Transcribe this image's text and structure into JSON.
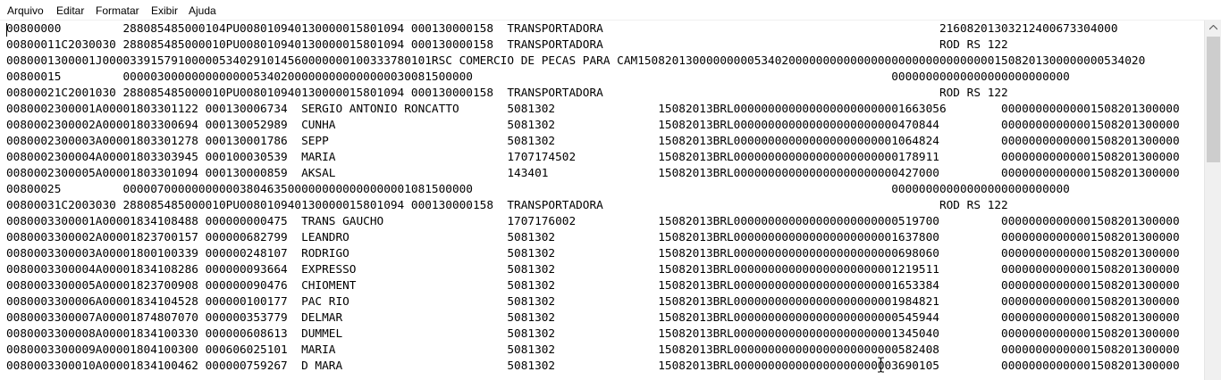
{
  "menu": {
    "items": [
      "Arquivo",
      "Editar",
      "Formatar",
      "Exibir",
      "Ajuda"
    ]
  },
  "document": {
    "lines": [
      "00800000         288085485000104PU008010940130000015801094 000130000158  TRANSPORTADORA                                                 21608201303212400673304000",
      "00800011C2030030 288085485000010PU008010940130000015801094 000130000158  TRANSPORTADORA                                                 ROD RS 122",
      "0080001300001J00003391579100000534029101456000000010033378010​1RSC COMERCIO DE PECAS PARA CAM15082013000000000534020000000000000000000000000000001508201300000000534020",
      "00800015         000003000000000000053402000000000000000030081500000                                                             00000000000000000000000000",
      "00800021C2001030 288085485000010PU008010940130000015801094 000130000158  TRANSPORTADORA                                                 ROD RS 122",
      "0080002300001A00001803301122 000130006734  SERGIO ANTONIO RONCATTO       5081302               15082013BRL0000000000000000000000001663056        00000000000001508201300000",
      "0080002300002A00001803300694 000130052989  CUNHA                         5081302               15082013BRL000000000000000000000000470844         00000000000001508201300000",
      "0080002300003A00001803301278 000130001786  SEPP                          5081302               15082013BRL000000000000000000000001064824         00000000000001508201300000",
      "0080002300004A00001803303945 000100030539  MARIA                         1707174502            15082013BRL000000000000000000000000178911         00000000000001508201300000",
      "0080002300005A00001803301094 000130000859  AKSAL                         143401                15082013BRL000000000000000000000000427000         00000000000001508201300000",
      "00800025         000007000000000003804635000000000000000001081500000                                                             00000000000000000000000000",
      "00800031C2003030 288085485000010PU008010940130000015801094 000130000158  TRANSPORTADORA                                                 ROD RS 122",
      "0080003300001A00001834108488 000000000475  TRANS GAUCHO                  1707176002            15082013BRL000000000000000000000000519700         00000000000001508201300000",
      "0080003300002A00001823700157 000000682799  LEANDRO                       5081302               15082013BRL000000000000000000000001637800         00000000000001508201300000",
      "0080003300003A00001800100339 000000248107  RODRIGO                       5081302               15082013BRL000000000000000000000000698060         00000000000001508201300000",
      "0080003300004A00001834108286 000000093664  EXPRESSO                      5081302               15082013BRL000000000000000000000001219511         00000000000001508201300000",
      "0080003300005A00001823700908 000000090476  CHIOMENT                      5081302               15082013BRL000000000000000000000001653384         00000000000001508201300000",
      "0080003300006A00001834104528 000000100177  PAC RIO                       5081302               15082013BRL000000000000000000000001984821         00000000000001508201300000",
      "0080003300007A00001874807070 000000353779  DELMAR                        5081302               15082013BRL000000000000000000000000545944         00000000000001508201300000",
      "0080003300008A00001834100330 000000608613  DUMMEL                        5081302               15082013BRL000000000000000000000001345040         00000000000001508201300000",
      "0080003300009A00001804100300 000606025101  MARIA                         5081302               15082013BRL000000000000000000000000582408         00000000000001508201300000",
      "0080003300010A00001834100462 000000759267  D MARA                        5081302               15082013BRL000000000000000000000003690105         00000000000001508201300000"
    ]
  }
}
